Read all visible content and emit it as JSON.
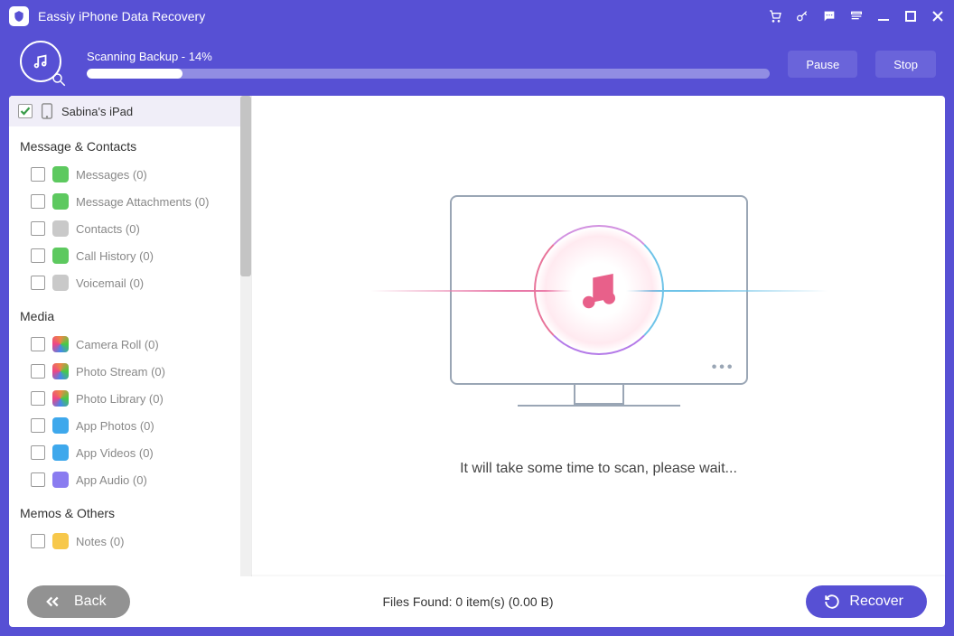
{
  "titlebar": {
    "title": "Eassiy iPhone Data Recovery"
  },
  "progress": {
    "label": "Scanning Backup - 14%",
    "percent": 14,
    "pause": "Pause",
    "stop": "Stop"
  },
  "device": {
    "name": "Sabina's iPad",
    "checked": true
  },
  "sections": [
    {
      "title": "Message & Contacts",
      "items": [
        {
          "label": "Messages (0)",
          "icon": "ic-green"
        },
        {
          "label": "Message Attachments (0)",
          "icon": "ic-green"
        },
        {
          "label": "Contacts (0)",
          "icon": "ic-grey"
        },
        {
          "label": "Call History (0)",
          "icon": "ic-green"
        },
        {
          "label": "Voicemail (0)",
          "icon": "ic-grey"
        }
      ]
    },
    {
      "title": "Media",
      "items": [
        {
          "label": "Camera Roll (0)",
          "icon": "ic-rainbow"
        },
        {
          "label": "Photo Stream (0)",
          "icon": "ic-rainbow"
        },
        {
          "label": "Photo Library (0)",
          "icon": "ic-rainbow"
        },
        {
          "label": "App Photos (0)",
          "icon": "ic-blue"
        },
        {
          "label": "App Videos (0)",
          "icon": "ic-blue"
        },
        {
          "label": "App Audio (0)",
          "icon": "ic-purple"
        }
      ]
    },
    {
      "title": "Memos & Others",
      "items": [
        {
          "label": "Notes (0)",
          "icon": "ic-yel"
        }
      ]
    }
  ],
  "content": {
    "message": "It will take some time to scan, please wait..."
  },
  "footer": {
    "back": "Back",
    "found": "Files Found: 0 item(s) (0.00 B)",
    "recover": "Recover"
  }
}
